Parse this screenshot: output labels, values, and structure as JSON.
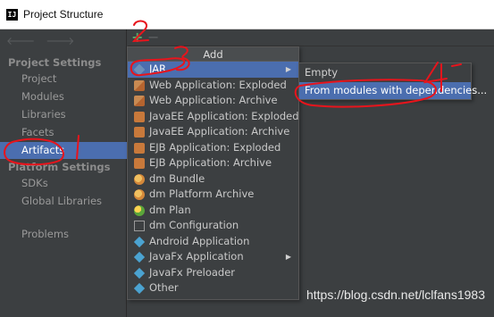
{
  "window": {
    "title": "Project Structure",
    "app_icon_text": "IJ"
  },
  "sidebar": {
    "nav_back": "🡐",
    "nav_forward": "🡒",
    "sections": [
      {
        "header": "Project Settings",
        "items": [
          "Project",
          "Modules",
          "Libraries",
          "Facets",
          "Artifacts"
        ]
      },
      {
        "header": "Platform Settings",
        "items": [
          "SDKs",
          "Global Libraries"
        ]
      }
    ],
    "problems": "Problems",
    "selected": "Artifacts"
  },
  "toolbar": {
    "add_glyph": "+",
    "remove_glyph": "−"
  },
  "add_menu": {
    "header": "Add",
    "items": [
      {
        "label": "JAR",
        "icon": "jar-icon",
        "submenu": true,
        "selected": true
      },
      {
        "label": "Web Application: Exploded",
        "icon": "web-app-icon"
      },
      {
        "label": "Web Application: Archive",
        "icon": "web-app-icon"
      },
      {
        "label": "JavaEE Application: Exploded",
        "icon": "javaee-icon"
      },
      {
        "label": "JavaEE Application: Archive",
        "icon": "javaee-icon"
      },
      {
        "label": "EJB Application: Exploded",
        "icon": "ejb-icon"
      },
      {
        "label": "EJB Application: Archive",
        "icon": "ejb-icon"
      },
      {
        "label": "dm Bundle",
        "icon": "dm-bundle-icon"
      },
      {
        "label": "dm Platform Archive",
        "icon": "dm-bundle-icon"
      },
      {
        "label": "dm Plan",
        "icon": "dm-plan-icon"
      },
      {
        "label": "dm Configuration",
        "icon": "config-icon"
      },
      {
        "label": "Android Application",
        "icon": "android-icon"
      },
      {
        "label": "JavaFx Application",
        "icon": "javafx-icon",
        "submenu": true
      },
      {
        "label": "JavaFx Preloader",
        "icon": "javafx-icon"
      },
      {
        "label": "Other",
        "icon": "other-icon"
      }
    ]
  },
  "submenu": {
    "items": [
      {
        "label": "Empty"
      },
      {
        "label": "From modules with dependencies...",
        "selected": true
      }
    ]
  },
  "annotations": [
    "1",
    "2",
    "3",
    "4"
  ],
  "watermark": "https://blog.csdn.net/lclfans1983",
  "colors": {
    "background": "#3c3f41",
    "selection": "#4b6eaf",
    "annotation_red": "#e8141c",
    "add_green": "#59a869"
  }
}
